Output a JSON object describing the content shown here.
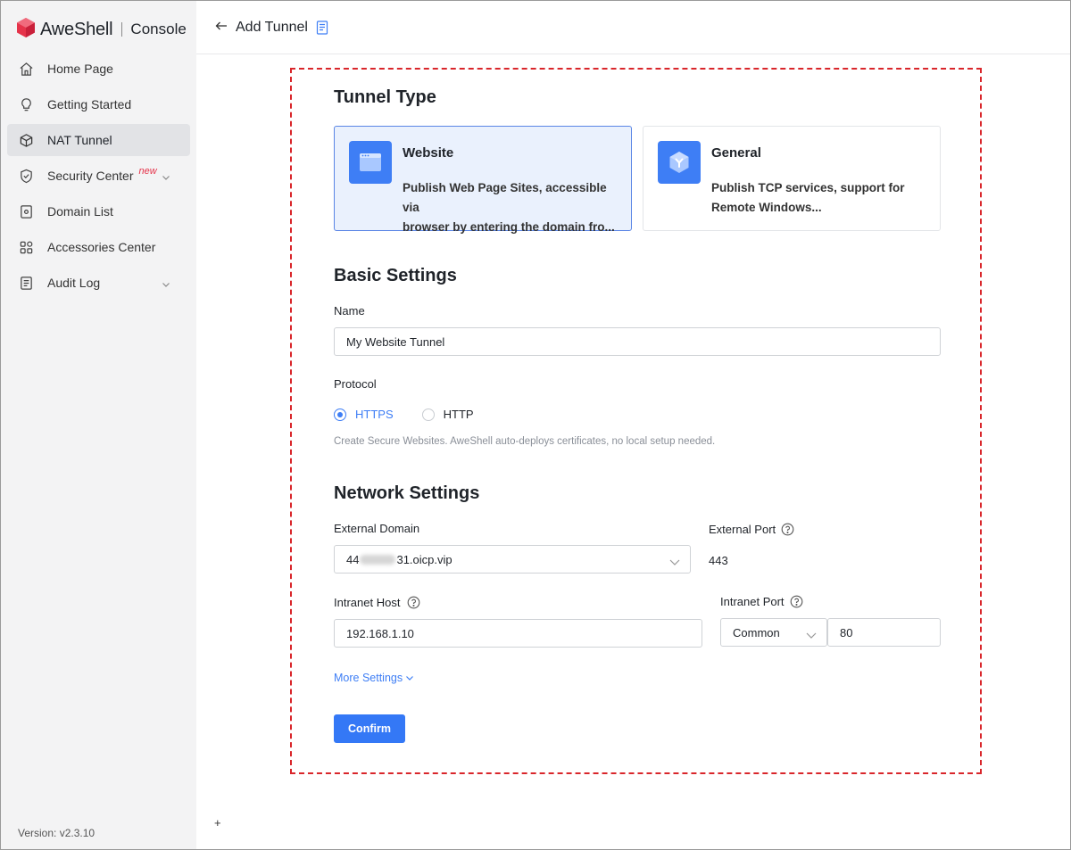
{
  "brand": {
    "name": "AweShell",
    "subtitle": "Console",
    "logo_color": "#e5334a"
  },
  "sidebar": {
    "items": [
      {
        "label": "Home Page",
        "icon": "home-icon"
      },
      {
        "label": "Getting Started",
        "icon": "lightbulb-icon"
      },
      {
        "label": "NAT Tunnel",
        "icon": "cube-icon",
        "active": true
      },
      {
        "label": "Security Center",
        "icon": "shield-icon",
        "badge": "new",
        "expandable": true
      },
      {
        "label": "Domain List",
        "icon": "domain-icon"
      },
      {
        "label": "Accessories Center",
        "icon": "grid-icon"
      },
      {
        "label": "Audit Log",
        "icon": "log-icon",
        "expandable": true
      }
    ],
    "version": "Version: v2.3.10"
  },
  "header": {
    "title": "Add Tunnel",
    "back_icon": "arrow-left-icon",
    "doc_icon": "document-icon"
  },
  "footer_mark": "+",
  "form": {
    "tunnel_type": {
      "title": "Tunnel Type",
      "options": [
        {
          "title": "Website",
          "desc_line1": "Publish Web Page Sites, accessible via",
          "desc_line2": "browser by entering the domain fro...",
          "icon": "browser-window-icon",
          "selected": true
        },
        {
          "title": "General",
          "desc_line1": "Publish TCP services, support for",
          "desc_line2": "Remote Windows...",
          "icon": "hexagon-y-icon",
          "selected": false
        }
      ]
    },
    "basic": {
      "title": "Basic Settings",
      "name_label": "Name",
      "name_value": "My Website Tunnel",
      "protocol_label": "Protocol",
      "protocols": [
        "HTTPS",
        "HTTP"
      ],
      "selected_protocol": "HTTPS",
      "hint": "Create Secure Websites. AweShell auto-deploys certificates, no local setup needed."
    },
    "network": {
      "title": "Network Settings",
      "external_domain_label": "External Domain",
      "external_domain_prefix": "44",
      "external_domain_suffix": "31.oicp.vip",
      "external_port_label": "External Port",
      "external_port_value": "443",
      "intranet_host_label": "Intranet Host",
      "intranet_host_value": "192.168.1.10",
      "intranet_port_label": "Intranet Port",
      "intranet_port_type": "Common",
      "intranet_port_value": "80"
    },
    "more_settings": "More Settings",
    "confirm": "Confirm"
  },
  "colors": {
    "accent": "#3e7ef5",
    "highlight_border": "#d9262b",
    "badge": "#e5334a"
  }
}
